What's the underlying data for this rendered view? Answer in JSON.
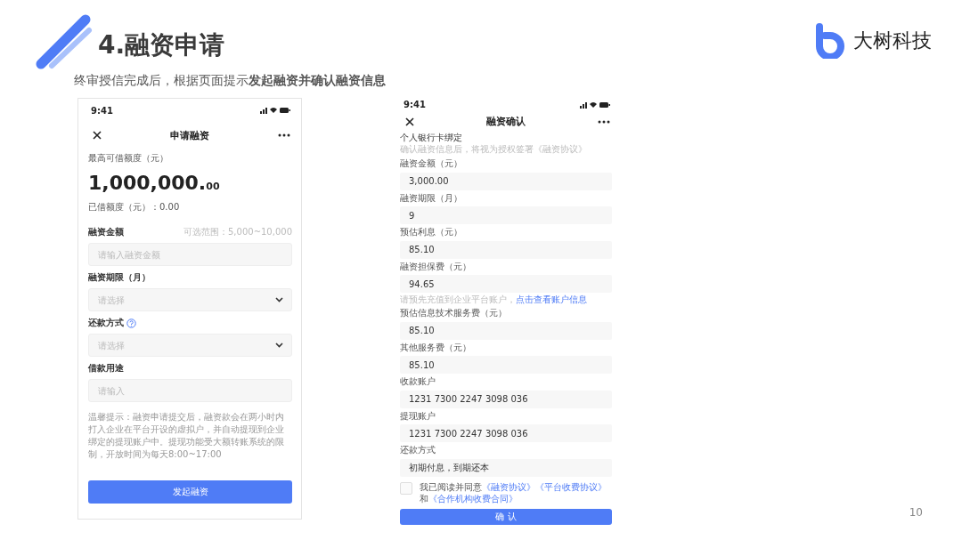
{
  "header": {
    "title": "4.融资申请",
    "subtitle": "终审授信完成后，根据页面提示**发起融资并确认融资信息**"
  },
  "logo": {
    "text": "大树科技"
  },
  "apply_screen": {
    "status_time": "9:41",
    "title": "申请融资",
    "limit_label": "最高可借额度（元）",
    "limit_amount": "1,000,000.",
    "limit_cents": "00",
    "used": "已借额度（元）：0.00",
    "fields": [
      {
        "kind": "input",
        "label": "融资金额",
        "hint": "可选范围：5,000~10,000",
        "help": false,
        "placeholder": "请输入融资金额"
      },
      {
        "kind": "select",
        "label": "融资期限（月）",
        "help": false,
        "placeholder": "请选择"
      },
      {
        "kind": "select",
        "label": "还款方式",
        "help": true,
        "placeholder": "请选择"
      },
      {
        "kind": "input",
        "label": "借款用途",
        "help": false,
        "placeholder": "请输入"
      }
    ],
    "notice": "温馨提示：融资申请提交后，融资款会在两小时内打入企业在平台开设的虚拟户，并自动提现到企业绑定的提现账户中。提现功能受大额转账系统的限制，开放时间为每天8:00~17:00",
    "button": "发起融资"
  },
  "confirm_screen": {
    "status_time": "9:41",
    "title": "融资确认",
    "section_title": "个人银行卡绑定",
    "section_note": "确认融资信息后，将视为授权签署《融资协议》",
    "items": [
      {
        "kind": "field",
        "label": "融资金额（元）",
        "value": "3,000.00"
      },
      {
        "kind": "field",
        "label": "融资期限（月）",
        "value": "9"
      },
      {
        "kind": "field",
        "label": "预估利息（元）",
        "value": "85.10"
      },
      {
        "kind": "field",
        "label": "融资担保费（元）",
        "value": "94.65"
      },
      {
        "kind": "note",
        "text": "请预先充值到企业平台账户，",
        "link": "点击查看账户信息"
      },
      {
        "kind": "field",
        "label": "预估信息技术服务费（元）",
        "value": "85.10"
      },
      {
        "kind": "field",
        "label": "其他服务费（元）",
        "value": "85.10"
      },
      {
        "kind": "field",
        "label": "收款账户",
        "value": "1231 7300 2247 3098 036"
      },
      {
        "kind": "field",
        "label": "提现账户",
        "value": "1231 7300 2247 3098 036"
      },
      {
        "kind": "field",
        "label": "还款方式",
        "value": "初期付息，到期还本"
      }
    ],
    "agreement": {
      "checked": false,
      "text": "我已阅读并同意",
      "links": [
        "《融资协议》",
        "《平台收费协议》"
      ],
      "joiner": "和",
      "last_link": "《合作机构收费合同》"
    },
    "button": "确 认"
  },
  "page_number": "10"
}
